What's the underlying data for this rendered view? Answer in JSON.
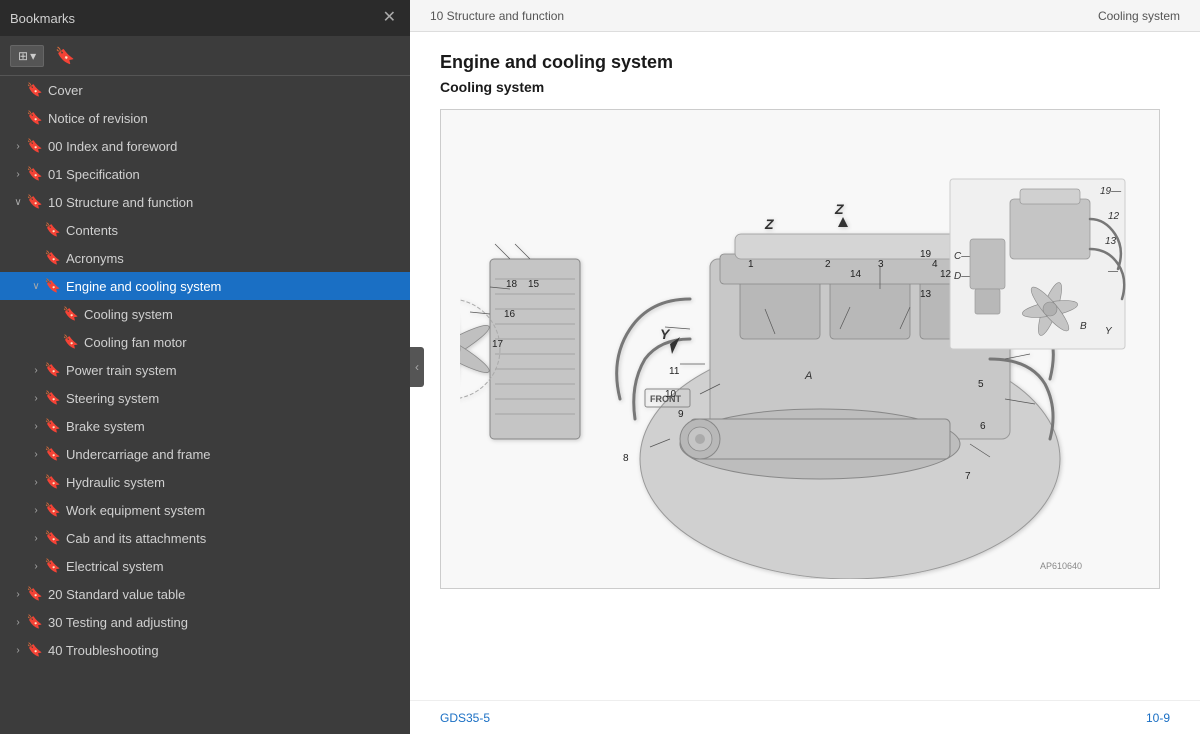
{
  "sidebar": {
    "title": "Bookmarks",
    "close_label": "✕",
    "toolbar": {
      "layout_icon": "⊞",
      "bookmark_icon": "🔖",
      "dropdown_arrow": "▾"
    },
    "items": [
      {
        "id": "cover",
        "label": "Cover",
        "level": 0,
        "has_children": false,
        "expanded": false,
        "active": false,
        "has_arrow": false
      },
      {
        "id": "notice",
        "label": "Notice of revision",
        "level": 0,
        "has_children": false,
        "expanded": false,
        "active": false,
        "has_arrow": false
      },
      {
        "id": "00-index",
        "label": "00 Index and foreword",
        "level": 0,
        "has_children": true,
        "expanded": false,
        "active": false,
        "has_arrow": true
      },
      {
        "id": "01-spec",
        "label": "01 Specification",
        "level": 0,
        "has_children": true,
        "expanded": false,
        "active": false,
        "has_arrow": true
      },
      {
        "id": "10-structure",
        "label": "10 Structure and function",
        "level": 0,
        "has_children": true,
        "expanded": true,
        "active": false,
        "has_arrow": true
      },
      {
        "id": "contents",
        "label": "Contents",
        "level": 1,
        "has_children": false,
        "expanded": false,
        "active": false,
        "has_arrow": false
      },
      {
        "id": "acronyms",
        "label": "Acronyms",
        "level": 1,
        "has_children": false,
        "expanded": false,
        "active": false,
        "has_arrow": false
      },
      {
        "id": "engine-cooling",
        "label": "Engine and cooling system",
        "level": 1,
        "has_children": true,
        "expanded": true,
        "active": true,
        "has_arrow": true
      },
      {
        "id": "cooling-system",
        "label": "Cooling system",
        "level": 2,
        "has_children": false,
        "expanded": false,
        "active": false,
        "has_arrow": false
      },
      {
        "id": "cooling-fan",
        "label": "Cooling fan motor",
        "level": 2,
        "has_children": false,
        "expanded": false,
        "active": false,
        "has_arrow": false
      },
      {
        "id": "power-train",
        "label": "Power train system",
        "level": 1,
        "has_children": true,
        "expanded": false,
        "active": false,
        "has_arrow": true
      },
      {
        "id": "steering",
        "label": "Steering system",
        "level": 1,
        "has_children": true,
        "expanded": false,
        "active": false,
        "has_arrow": true
      },
      {
        "id": "brake",
        "label": "Brake system",
        "level": 1,
        "has_children": true,
        "expanded": false,
        "active": false,
        "has_arrow": true
      },
      {
        "id": "undercarriage",
        "label": "Undercarriage and frame",
        "level": 1,
        "has_children": true,
        "expanded": false,
        "active": false,
        "has_arrow": true
      },
      {
        "id": "hydraulic",
        "label": "Hydraulic system",
        "level": 1,
        "has_children": true,
        "expanded": false,
        "active": false,
        "has_arrow": true
      },
      {
        "id": "work-equip",
        "label": "Work equipment system",
        "level": 1,
        "has_children": true,
        "expanded": false,
        "active": false,
        "has_arrow": true
      },
      {
        "id": "cab",
        "label": "Cab and its attachments",
        "level": 1,
        "has_children": true,
        "expanded": false,
        "active": false,
        "has_arrow": true
      },
      {
        "id": "electrical",
        "label": "Electrical system",
        "level": 1,
        "has_children": true,
        "expanded": false,
        "active": false,
        "has_arrow": true
      },
      {
        "id": "20-standard",
        "label": "20 Standard value table",
        "level": 0,
        "has_children": true,
        "expanded": false,
        "active": false,
        "has_arrow": true
      },
      {
        "id": "30-testing",
        "label": "30 Testing and adjusting",
        "level": 0,
        "has_children": true,
        "expanded": false,
        "active": false,
        "has_arrow": true
      },
      {
        "id": "40-trouble",
        "label": "40 Troubleshooting",
        "level": 0,
        "has_children": true,
        "expanded": false,
        "active": false,
        "has_arrow": true
      }
    ]
  },
  "main": {
    "header_left": "10 Structure and function",
    "header_right": "Cooling system",
    "doc_title": "Engine and cooling system",
    "doc_subtitle": "Cooling system",
    "diagram_caption": "AP610640",
    "footer_left": "GDS35-5",
    "footer_right": "10-9",
    "diagram_numbers": [
      "1",
      "2",
      "3",
      "4",
      "5",
      "6",
      "7",
      "8",
      "9",
      "10",
      "11",
      "12",
      "13",
      "14",
      "15",
      "16",
      "17",
      "18",
      "19",
      "A",
      "B",
      "C",
      "D",
      "Y",
      "Z"
    ],
    "diagram_labels": {
      "front_label": "FRONT"
    }
  }
}
